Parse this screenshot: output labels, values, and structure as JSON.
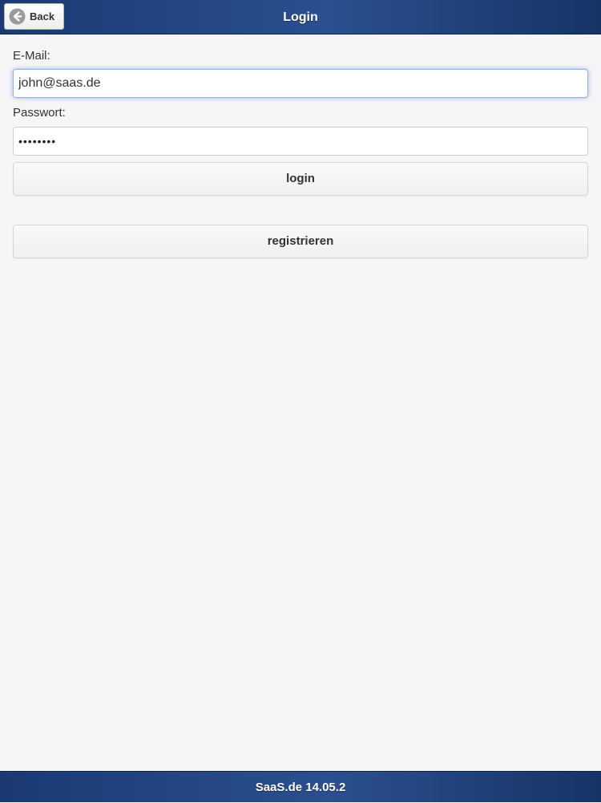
{
  "header": {
    "title": "Login",
    "back_label": "Back",
    "back_icon": "arrow-left-circle-icon"
  },
  "form": {
    "email_label": "E-Mail:",
    "email_value": "john@saas.de",
    "password_label": "Passwort:",
    "password_display": "••••••••",
    "login_label": "login",
    "register_label": "registrieren"
  },
  "footer": {
    "text": "SaaS.de 14.05.2"
  },
  "colors": {
    "bar_primary": "#2b4f8f",
    "background": "#f6f6f8",
    "focus_glow": "#8fb4dd"
  }
}
